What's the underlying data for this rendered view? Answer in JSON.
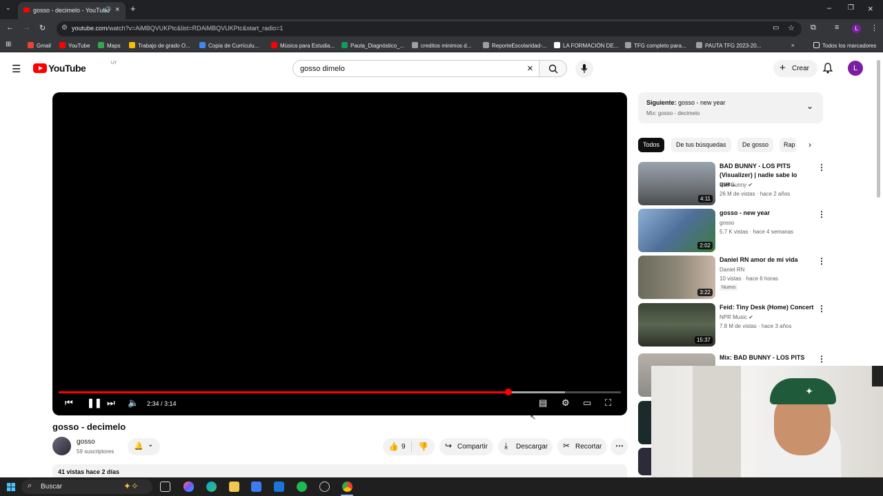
{
  "browser": {
    "tab_title": "gosso - decimelo - YouTube",
    "url_host": "youtube.com",
    "url_path": "/watch?v=AiMBQVUKPtc&list=RDAiMBQVUKPtc&start_radio=1",
    "bookmarks": [
      {
        "label": "Gmail",
        "color": "#ea4335"
      },
      {
        "label": "YouTube",
        "color": "#ff0000"
      },
      {
        "label": "Maps",
        "color": "#34a853"
      },
      {
        "label": "Trabajo de grado O...",
        "color": "#fbbc04"
      },
      {
        "label": "Copia de Currículu...",
        "color": "#4285f4"
      },
      {
        "label": "Música para Estudia...",
        "color": "#ff0000"
      },
      {
        "label": "Pauta_Diagnóstico_...",
        "color": "#0f9d58"
      },
      {
        "label": "creditos minimos d...",
        "color": "#9aa0a6"
      },
      {
        "label": "ReporteEscolaridad-...",
        "color": "#9aa0a6"
      },
      {
        "label": "LA FORMACIÓN DE...",
        "color": "#ffffff"
      },
      {
        "label": "TFG completo para...",
        "color": "#9aa0a6"
      },
      {
        "label": "PAUTA TFG 2023-20...",
        "color": "#9aa0a6"
      }
    ],
    "all_bookmarks": "Todos los marcadores"
  },
  "youtube": {
    "logo_text": "YouTube",
    "country": "UY",
    "search_query": "gosso dimelo",
    "create_label": "Crear",
    "avatar_letter": "L"
  },
  "player": {
    "time": "2:34 / 3:14",
    "progress": 0.8,
    "buffered": 0.9
  },
  "video": {
    "title": "gosso - decimelo",
    "channel": "gosso",
    "subscribers": "59 suscriptores",
    "likes": "9",
    "share_label": "Compartir",
    "download_label": "Descargar",
    "clip_label": "Recortar",
    "stats": "41 vistas  hace 2 días"
  },
  "sidebar": {
    "next_label": "Siguiente:",
    "next_title": "gosso - new year",
    "next_sub": "Mix: gosso - decimelo",
    "chips": [
      "Todos",
      "De tus búsquedas",
      "De gosso",
      "Rap"
    ],
    "items": [
      {
        "title": "BAD BUNNY - LOS PITS (Visualizer) | nadie sabe lo que...",
        "channel": "Bad Bunny",
        "verified": true,
        "meta": "26 M de vistas · hace 2 años",
        "duration": "4:11",
        "thumb": "#7a7f86"
      },
      {
        "title": "gosso - new year",
        "channel": "gosso",
        "verified": false,
        "meta": "5.7 K vistas · hace 4 semanas",
        "duration": "2:02",
        "thumb": "#5f7fa8"
      },
      {
        "title": "Daniel RN amor de mi vida",
        "channel": "Daniel RN",
        "verified": false,
        "meta": "10 vistas · hace 6 horas",
        "badge": "Nuevo",
        "duration": "3:22",
        "thumb": "#6f6a58"
      },
      {
        "title": "Feid: Tiny Desk (Home) Concert",
        "channel": "NPR Music",
        "verified": true,
        "meta": "7.8 M de vistas · hace 3 años",
        "duration": "15:37",
        "thumb": "#4f5a4a"
      },
      {
        "title": "Mix: BAD BUNNY - LOS PITS",
        "channel": "",
        "verified": false,
        "meta": "",
        "duration": "",
        "thumb": "#8d8a86"
      }
    ]
  },
  "taskbar": {
    "search_label": "Buscar"
  }
}
